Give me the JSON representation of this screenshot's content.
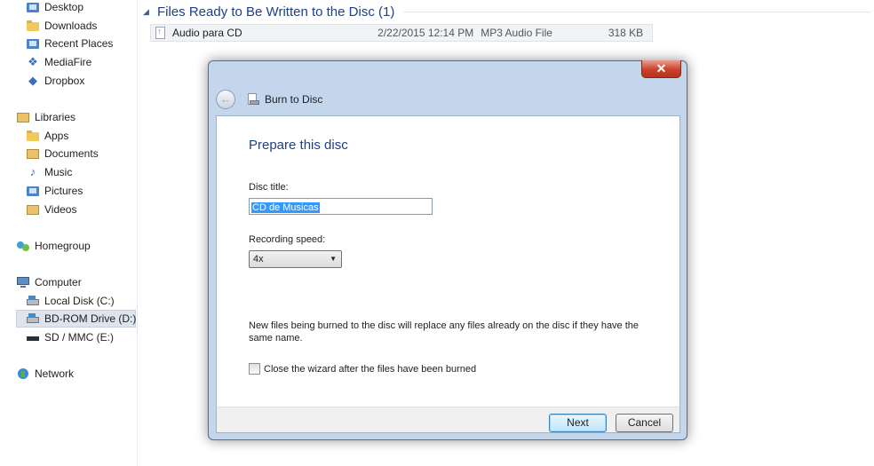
{
  "nav": {
    "items": [
      {
        "label": "Desktop",
        "icon": "desktop-folder-icon"
      },
      {
        "label": "Downloads",
        "icon": "downloads-folder-icon"
      },
      {
        "label": "Recent Places",
        "icon": "recent-places-icon"
      },
      {
        "label": "MediaFire",
        "icon": "mediafire-icon"
      },
      {
        "label": "Dropbox",
        "icon": "dropbox-icon"
      },
      {
        "label": "Libraries",
        "icon": "libraries-icon"
      },
      {
        "label": "Apps",
        "icon": "apps-folder-icon"
      },
      {
        "label": "Documents",
        "icon": "documents-icon"
      },
      {
        "label": "Music",
        "icon": "music-icon"
      },
      {
        "label": "Pictures",
        "icon": "pictures-icon"
      },
      {
        "label": "Videos",
        "icon": "videos-icon"
      },
      {
        "label": "Homegroup",
        "icon": "homegroup-icon"
      },
      {
        "label": "Computer",
        "icon": "computer-icon"
      },
      {
        "label": "Local Disk (C:)",
        "icon": "local-disk-icon"
      },
      {
        "label": "BD-ROM Drive (D:)",
        "icon": "bd-rom-drive-icon"
      },
      {
        "label": "SD / MMC (E:)",
        "icon": "sd-card-icon"
      },
      {
        "label": "Network",
        "icon": "network-icon"
      }
    ]
  },
  "content": {
    "group_title": "Files Ready to Be Written to the Disc (1)",
    "file": {
      "name": "Audio para CD",
      "date": "2/22/2015 12:14 PM",
      "type": "MP3 Audio File",
      "size": "318 KB"
    }
  },
  "dialog": {
    "title": "Burn to Disc",
    "close_label": "✕",
    "back_label": "←",
    "heading": "Prepare this disc",
    "disc_title_label": "Disc title:",
    "disc_title_value": "CD de Musicas",
    "speed_label": "Recording speed:",
    "speed_value": "4x",
    "note": "New files being burned to the disc will replace any files already on the disc if they have the same name.",
    "checkbox_label": "Close the wizard after the files have been burned",
    "checkbox_checked": false,
    "next_label": "Next",
    "cancel_label": "Cancel"
  },
  "colors": {
    "heading_blue": "#1e3e8e",
    "dialog_frame": "#c3d6ec",
    "close_red": "#c9412a",
    "selection_highlight": "#3399ff"
  }
}
